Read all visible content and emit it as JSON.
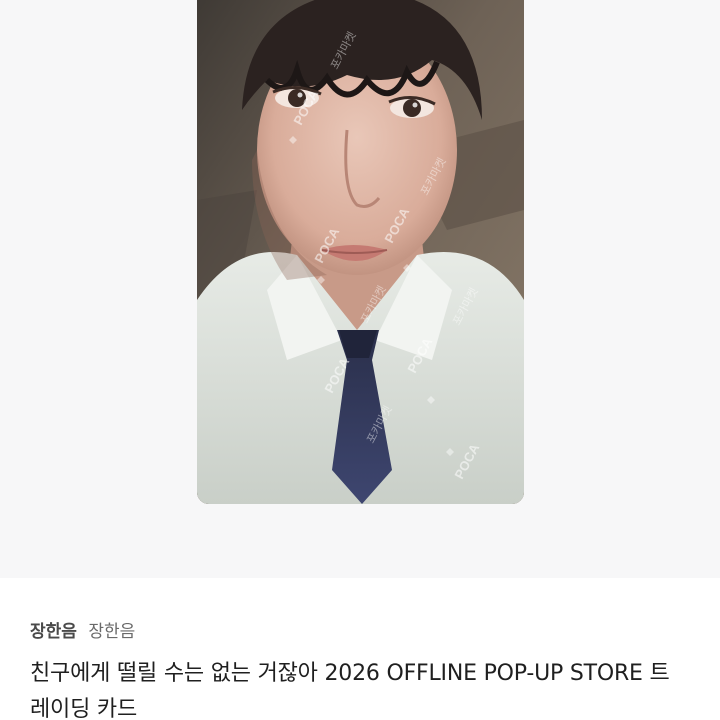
{
  "product": {
    "group_name": "장한음",
    "member_name": "장한음",
    "title": "친구에게 떨릴 수는 없는 거잖아 2026 OFFLINE POP-UP STORE 트레이딩 카드"
  },
  "watermark": {
    "brand": "POCA",
    "korean": "포카마켓"
  },
  "colors": {
    "photo_background": "#f7f7f8",
    "text_primary": "#1f1f1f",
    "text_secondary": "#6a6a6a"
  }
}
